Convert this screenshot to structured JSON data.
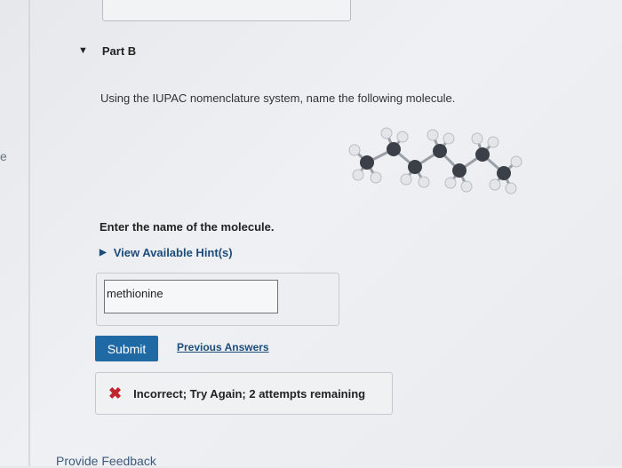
{
  "edge_text": "e",
  "part": {
    "title": "Part B"
  },
  "question": {
    "text": "Using the IUPAC nomenclature system, name the following molecule."
  },
  "molecule": {
    "icon": "ball-and-stick-molecule-icon",
    "colors": {
      "carbon": "#3b3f48",
      "hydrogen": "#e3e5e8",
      "bond": "#9aa0a8"
    }
  },
  "prompt": {
    "text": "Enter the name of the molecule."
  },
  "hint": {
    "label": "View Available Hint(s)"
  },
  "answer": {
    "value": "methionine",
    "placeholder": ""
  },
  "actions": {
    "submit_label": "Submit",
    "previous_answers_label": "Previous Answers"
  },
  "feedback": {
    "text": "Incorrect; Try Again; 2 attempts remaining",
    "status_color": "#c0262d"
  },
  "footer": {
    "provide_feedback_label": "Provide Feedback"
  },
  "colors": {
    "accent": "#1f6aa5",
    "link": "#1c4c7a"
  }
}
